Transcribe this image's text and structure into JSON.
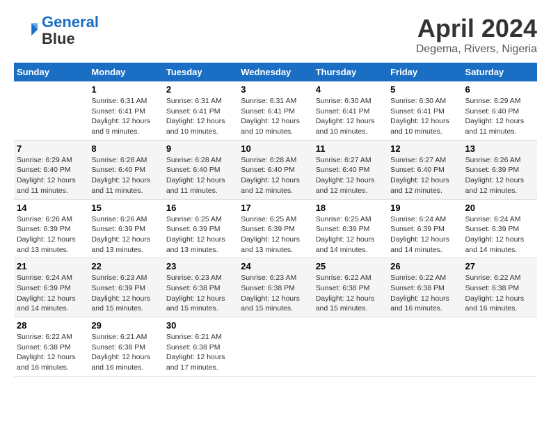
{
  "header": {
    "logo_line1": "General",
    "logo_line2": "Blue",
    "month_title": "April 2024",
    "location": "Degema, Rivers, Nigeria"
  },
  "days_of_week": [
    "Sunday",
    "Monday",
    "Tuesday",
    "Wednesday",
    "Thursday",
    "Friday",
    "Saturday"
  ],
  "weeks": [
    [
      {
        "day": "",
        "sunrise": "",
        "sunset": "",
        "daylight": ""
      },
      {
        "day": "1",
        "sunrise": "Sunrise: 6:31 AM",
        "sunset": "Sunset: 6:41 PM",
        "daylight": "Daylight: 12 hours and 9 minutes."
      },
      {
        "day": "2",
        "sunrise": "Sunrise: 6:31 AM",
        "sunset": "Sunset: 6:41 PM",
        "daylight": "Daylight: 12 hours and 10 minutes."
      },
      {
        "day": "3",
        "sunrise": "Sunrise: 6:31 AM",
        "sunset": "Sunset: 6:41 PM",
        "daylight": "Daylight: 12 hours and 10 minutes."
      },
      {
        "day": "4",
        "sunrise": "Sunrise: 6:30 AM",
        "sunset": "Sunset: 6:41 PM",
        "daylight": "Daylight: 12 hours and 10 minutes."
      },
      {
        "day": "5",
        "sunrise": "Sunrise: 6:30 AM",
        "sunset": "Sunset: 6:41 PM",
        "daylight": "Daylight: 12 hours and 10 minutes."
      },
      {
        "day": "6",
        "sunrise": "Sunrise: 6:29 AM",
        "sunset": "Sunset: 6:40 PM",
        "daylight": "Daylight: 12 hours and 11 minutes."
      }
    ],
    [
      {
        "day": "7",
        "sunrise": "Sunrise: 6:29 AM",
        "sunset": "Sunset: 6:40 PM",
        "daylight": "Daylight: 12 hours and 11 minutes."
      },
      {
        "day": "8",
        "sunrise": "Sunrise: 6:28 AM",
        "sunset": "Sunset: 6:40 PM",
        "daylight": "Daylight: 12 hours and 11 minutes."
      },
      {
        "day": "9",
        "sunrise": "Sunrise: 6:28 AM",
        "sunset": "Sunset: 6:40 PM",
        "daylight": "Daylight: 12 hours and 11 minutes."
      },
      {
        "day": "10",
        "sunrise": "Sunrise: 6:28 AM",
        "sunset": "Sunset: 6:40 PM",
        "daylight": "Daylight: 12 hours and 12 minutes."
      },
      {
        "day": "11",
        "sunrise": "Sunrise: 6:27 AM",
        "sunset": "Sunset: 6:40 PM",
        "daylight": "Daylight: 12 hours and 12 minutes."
      },
      {
        "day": "12",
        "sunrise": "Sunrise: 6:27 AM",
        "sunset": "Sunset: 6:40 PM",
        "daylight": "Daylight: 12 hours and 12 minutes."
      },
      {
        "day": "13",
        "sunrise": "Sunrise: 6:26 AM",
        "sunset": "Sunset: 6:39 PM",
        "daylight": "Daylight: 12 hours and 12 minutes."
      }
    ],
    [
      {
        "day": "14",
        "sunrise": "Sunrise: 6:26 AM",
        "sunset": "Sunset: 6:39 PM",
        "daylight": "Daylight: 12 hours and 13 minutes."
      },
      {
        "day": "15",
        "sunrise": "Sunrise: 6:26 AM",
        "sunset": "Sunset: 6:39 PM",
        "daylight": "Daylight: 12 hours and 13 minutes."
      },
      {
        "day": "16",
        "sunrise": "Sunrise: 6:25 AM",
        "sunset": "Sunset: 6:39 PM",
        "daylight": "Daylight: 12 hours and 13 minutes."
      },
      {
        "day": "17",
        "sunrise": "Sunrise: 6:25 AM",
        "sunset": "Sunset: 6:39 PM",
        "daylight": "Daylight: 12 hours and 13 minutes."
      },
      {
        "day": "18",
        "sunrise": "Sunrise: 6:25 AM",
        "sunset": "Sunset: 6:39 PM",
        "daylight": "Daylight: 12 hours and 14 minutes."
      },
      {
        "day": "19",
        "sunrise": "Sunrise: 6:24 AM",
        "sunset": "Sunset: 6:39 PM",
        "daylight": "Daylight: 12 hours and 14 minutes."
      },
      {
        "day": "20",
        "sunrise": "Sunrise: 6:24 AM",
        "sunset": "Sunset: 6:39 PM",
        "daylight": "Daylight: 12 hours and 14 minutes."
      }
    ],
    [
      {
        "day": "21",
        "sunrise": "Sunrise: 6:24 AM",
        "sunset": "Sunset: 6:39 PM",
        "daylight": "Daylight: 12 hours and 14 minutes."
      },
      {
        "day": "22",
        "sunrise": "Sunrise: 6:23 AM",
        "sunset": "Sunset: 6:39 PM",
        "daylight": "Daylight: 12 hours and 15 minutes."
      },
      {
        "day": "23",
        "sunrise": "Sunrise: 6:23 AM",
        "sunset": "Sunset: 6:38 PM",
        "daylight": "Daylight: 12 hours and 15 minutes."
      },
      {
        "day": "24",
        "sunrise": "Sunrise: 6:23 AM",
        "sunset": "Sunset: 6:38 PM",
        "daylight": "Daylight: 12 hours and 15 minutes."
      },
      {
        "day": "25",
        "sunrise": "Sunrise: 6:22 AM",
        "sunset": "Sunset: 6:38 PM",
        "daylight": "Daylight: 12 hours and 15 minutes."
      },
      {
        "day": "26",
        "sunrise": "Sunrise: 6:22 AM",
        "sunset": "Sunset: 6:38 PM",
        "daylight": "Daylight: 12 hours and 16 minutes."
      },
      {
        "day": "27",
        "sunrise": "Sunrise: 6:22 AM",
        "sunset": "Sunset: 6:38 PM",
        "daylight": "Daylight: 12 hours and 16 minutes."
      }
    ],
    [
      {
        "day": "28",
        "sunrise": "Sunrise: 6:22 AM",
        "sunset": "Sunset: 6:38 PM",
        "daylight": "Daylight: 12 hours and 16 minutes."
      },
      {
        "day": "29",
        "sunrise": "Sunrise: 6:21 AM",
        "sunset": "Sunset: 6:38 PM",
        "daylight": "Daylight: 12 hours and 16 minutes."
      },
      {
        "day": "30",
        "sunrise": "Sunrise: 6:21 AM",
        "sunset": "Sunset: 6:38 PM",
        "daylight": "Daylight: 12 hours and 17 minutes."
      },
      {
        "day": "",
        "sunrise": "",
        "sunset": "",
        "daylight": ""
      },
      {
        "day": "",
        "sunrise": "",
        "sunset": "",
        "daylight": ""
      },
      {
        "day": "",
        "sunrise": "",
        "sunset": "",
        "daylight": ""
      },
      {
        "day": "",
        "sunrise": "",
        "sunset": "",
        "daylight": ""
      }
    ]
  ]
}
